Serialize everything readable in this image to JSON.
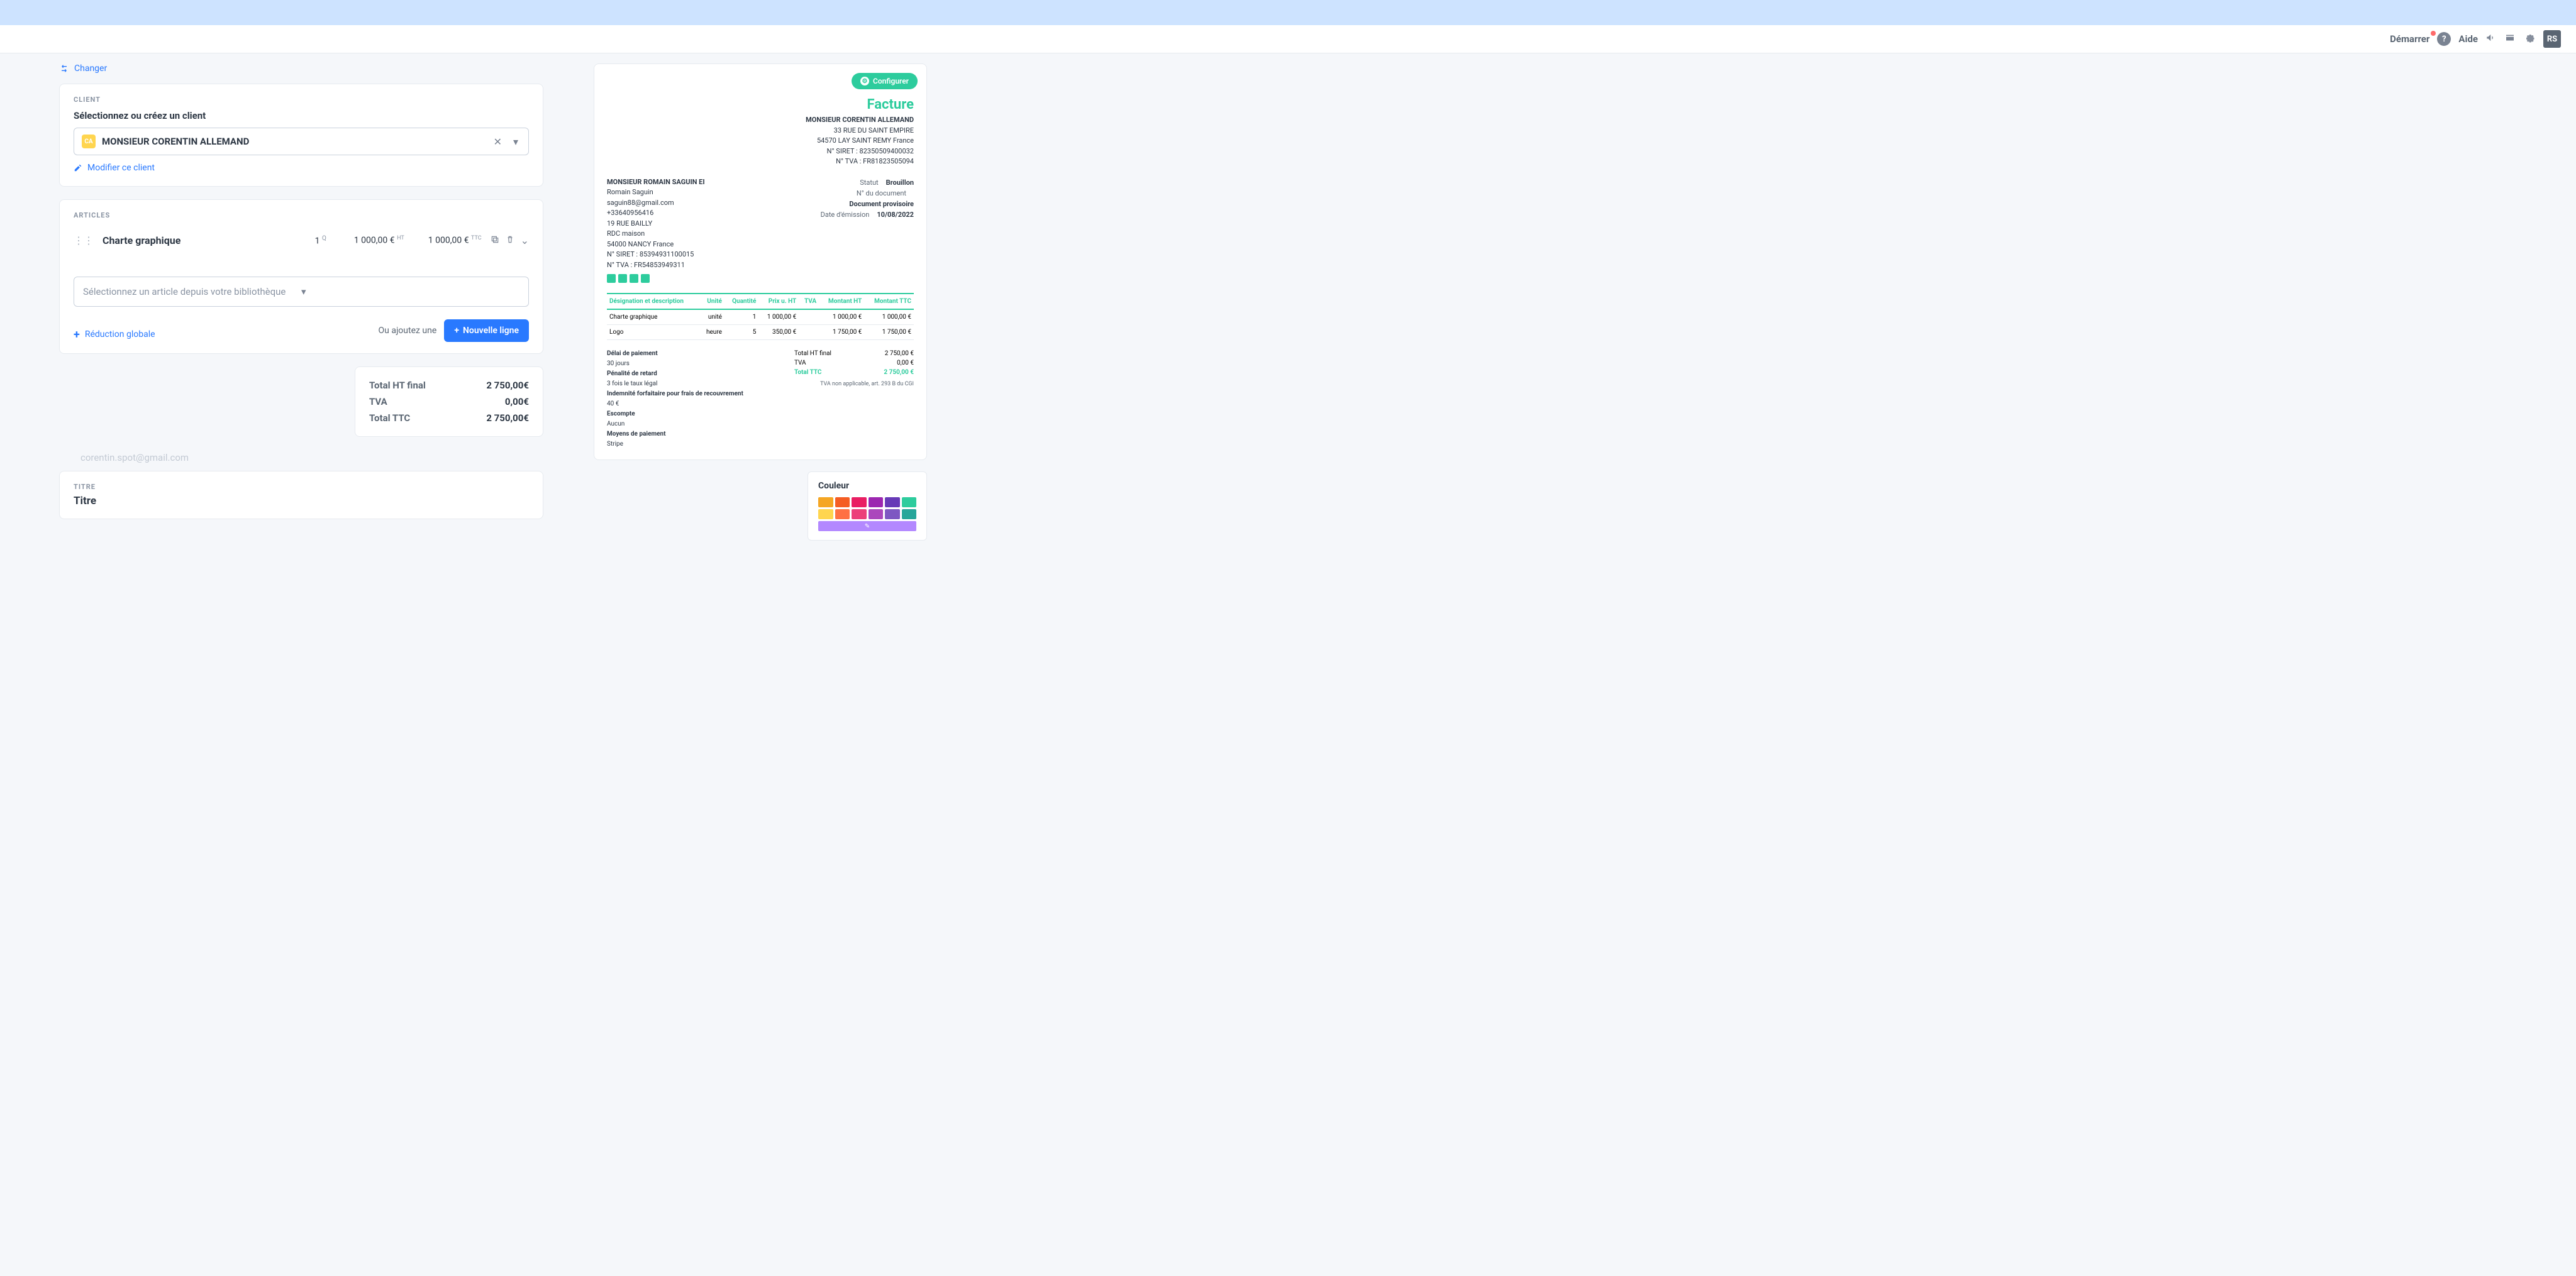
{
  "header": {
    "demarer": "Démarrer",
    "aide": "Aide",
    "avatar": "RS"
  },
  "left": {
    "changer": "Changer",
    "client": {
      "section": "CLIENT",
      "prompt": "Sélectionnez ou créez un client",
      "value": "MONSIEUR CORENTIN ALLEMAND",
      "avatar": "CA",
      "modify": "Modifier ce client"
    },
    "articles": {
      "section": "ARTICLES",
      "item": {
        "name": "Charte graphique",
        "qty": "1",
        "qty_unit": "Q",
        "price_ht": "1 000,00 €",
        "ht_suffix": "HT",
        "price_ttc": "1 000,00 €",
        "ttc_suffix": "TTC"
      },
      "select_placeholder": "Sélectionnez un article depuis votre bibliothèque",
      "reduction": "Réduction globale",
      "or_text": "Ou ajoutez une",
      "new_line": "Nouvelle ligne"
    },
    "totals": {
      "ht_label": "Total HT final",
      "ht_val": "2 750,00€",
      "tva_label": "TVA",
      "tva_val": "0,00€",
      "ttc_label": "Total TTC",
      "ttc_val": "2 750,00€"
    },
    "email": "corentin.spot@gmail.com",
    "titre": {
      "section": "TITRE",
      "value": "Titre"
    }
  },
  "preview": {
    "configure": "Configurer",
    "facture": "Facture",
    "client": {
      "name": "MONSIEUR CORENTIN ALLEMAND",
      "addr1": "33 RUE DU SAINT EMPIRE",
      "addr2": "54570 LAY SAINT REMY France",
      "siret": "N° SIRET : 82350509400032",
      "tva": "N° TVA : FR81823505094"
    },
    "sender": {
      "name": "MONSIEUR ROMAIN SAGUIN EI",
      "person": "Romain Saguin",
      "email": "saguin88@gmail.com",
      "phone": "+33640956416",
      "addr1": "19 RUE BAILLY",
      "addr2": "RDC maison",
      "addr3": "54000 NANCY France",
      "siret": "N° SIRET : 85394931100015",
      "tva": "N° TVA : FR54853949311"
    },
    "meta": {
      "status_l": "Statut",
      "status_v": "Brouillon",
      "doc_l": "N° du document",
      "doc_v": "Document provisoire",
      "date_l": "Date d'émission",
      "date_v": "10/08/2022"
    },
    "table": {
      "headers": [
        "Désignation et description",
        "Unité",
        "Quantité",
        "Prix u. HT",
        "TVA",
        "Montant HT",
        "Montant TTC"
      ],
      "rows": [
        {
          "name": "Charte graphique",
          "unit": "unité",
          "qty": "1",
          "pu": "1 000,00 €",
          "tva": "",
          "ht": "1 000,00 €",
          "ttc": "1 000,00 €"
        },
        {
          "name": "Logo",
          "unit": "heure",
          "qty": "5",
          "pu": "350,00 €",
          "tva": "",
          "ht": "1 750,00 €",
          "ttc": "1 750,00 €"
        }
      ]
    },
    "terms": {
      "delai_h": "Délai de paiement",
      "delai_v": "30 jours",
      "pen_h": "Pénalité de retard",
      "pen_v": "3 fois le taux légal",
      "ind_h": "Indemnité forfaitaire pour frais de recouvrement",
      "ind_v": "40 €",
      "esc_h": "Escompte",
      "esc_v": "Aucun",
      "moy_h": "Moyens de paiement",
      "moy_v": "Stripe"
    },
    "ptotals": {
      "ht_l": "Total HT final",
      "ht_v": "2 750,00 €",
      "tva_l": "TVA",
      "tva_v": "0,00 €",
      "ttc_l": "Total TTC",
      "ttc_v": "2 750,00 €",
      "vat_note": "TVA non applicable, art. 293 B du CGI"
    }
  },
  "colors": {
    "title": "Couleur",
    "swatches": [
      "#f5a623",
      "#f55d23",
      "#e91e63",
      "#9c27b0",
      "#673ab7",
      "#2dcc9d",
      "#ffd54f",
      "#ff7043",
      "#ec407a",
      "#ab47bc",
      "#7e57c2",
      "#26a69a"
    ],
    "custom": "#b388ff"
  }
}
